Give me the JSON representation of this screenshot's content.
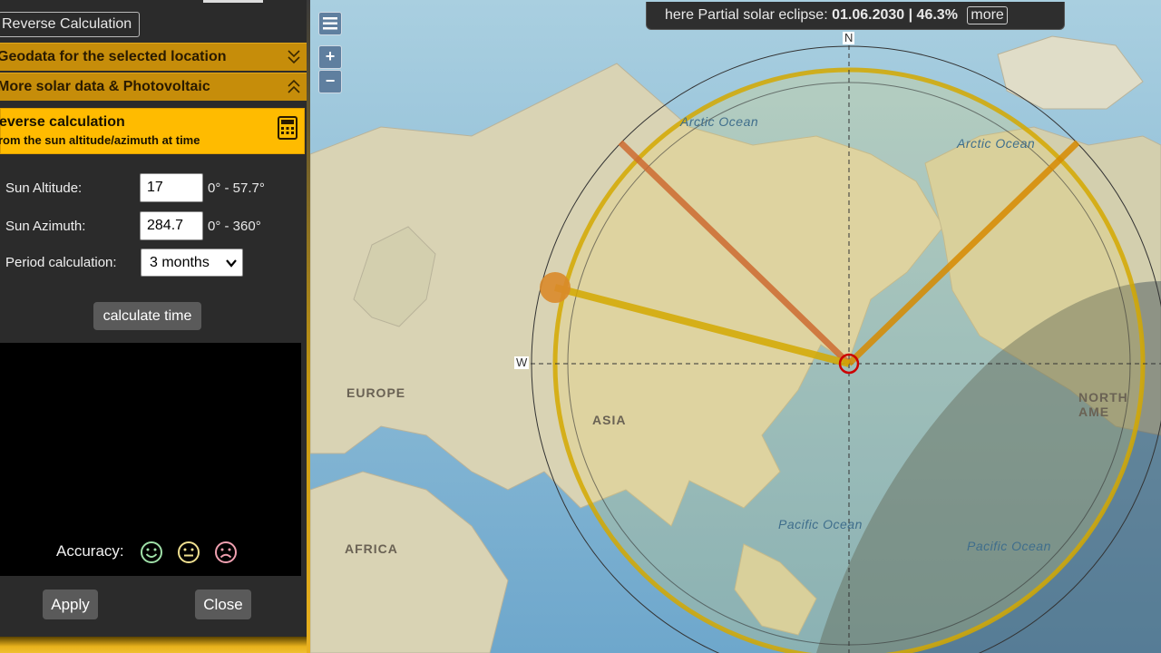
{
  "panel": {
    "reverse_button": "Reverse Calculation",
    "accordion": [
      {
        "label": "Geodata for the selected location",
        "icon": "chevron-double-down-icon"
      },
      {
        "label": "More solar data & Photovoltaic",
        "icon": "chevron-double-up-icon"
      }
    ],
    "calc": {
      "title": "everse calculation",
      "subtitle": "rom the sun altitude/azimuth at time",
      "icon": "calculator-icon"
    },
    "fields": {
      "altitude_label": "Sun Altitude:",
      "altitude_value": "17",
      "altitude_range": "0° - 57.7°",
      "azimuth_label": "Sun Azimuth:",
      "azimuth_value": "284.7",
      "azimuth_range": "0° - 360°",
      "period_label": "Period calculation:",
      "period_value": "3 months"
    },
    "calculate_button": "calculate time",
    "accuracy_label": "Accuracy:",
    "smileys": [
      {
        "name": "happy-face-icon",
        "color": "#9fe0a8"
      },
      {
        "name": "neutral-face-icon",
        "color": "#f0e090"
      },
      {
        "name": "sad-face-icon",
        "color": "#f0a0b0"
      }
    ],
    "apply_button": "Apply",
    "close_button": "Close"
  },
  "map": {
    "eclipse_prefix": "here Partial solar eclipse:",
    "eclipse_date": "01.06.2030",
    "eclipse_percent": "46.3%",
    "more_button": "more",
    "compass_n": "N",
    "compass_w": "W",
    "zoom_in": "+",
    "zoom_out": "−",
    "regions": [
      "EUROPE",
      "ASIA",
      "AFRICA",
      "NORTH AME"
    ],
    "oceans": [
      "Arctic Ocean",
      "Arctic Ocean",
      "Pacific Ocean",
      "Pacific Ocean"
    ],
    "colors": {
      "sun_line": "#d4a800",
      "sunrise_line": "#cc6a30",
      "sunset_line": "#d68a00",
      "accent": "#ffbb00"
    }
  }
}
